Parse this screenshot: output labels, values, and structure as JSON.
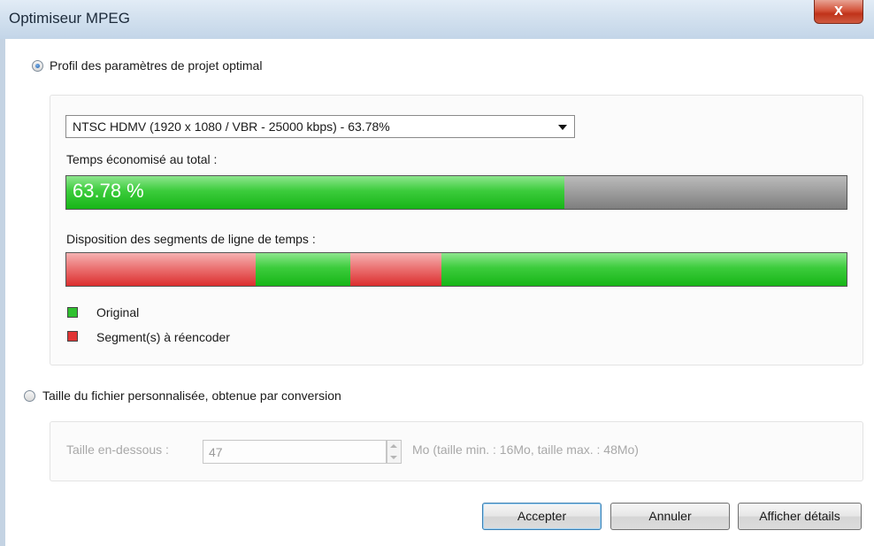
{
  "window": {
    "title": "Optimiseur MPEG",
    "close_glyph": "x"
  },
  "optimal_profile": {
    "radio_label": "Profil des paramètres de projet optimal",
    "selected": true,
    "profile_select_value": "NTSC HDMV (1920 x 1080 / VBR - 25000 kbps) - 63.78%",
    "time_saved_label": "Temps économisé au total :",
    "time_saved_percent": 63.78,
    "time_saved_text": "63.78 %",
    "timeline_label": "Disposition des segments de ligne de temps :",
    "timeline_segments": [
      {
        "type": "reencode",
        "start": 0.0,
        "end": 0.243
      },
      {
        "type": "original",
        "start": 0.243,
        "end": 0.364
      },
      {
        "type": "reencode",
        "start": 0.364,
        "end": 0.481
      },
      {
        "type": "original",
        "start": 0.481,
        "end": 1.0
      }
    ],
    "legend": [
      {
        "color": "#2fc02f",
        "label": "Original"
      },
      {
        "color": "#e03535",
        "label": "Segment(s) à réencoder"
      }
    ]
  },
  "custom_size": {
    "radio_label": "Taille du fichier personnalisée, obtenue par conversion",
    "selected": false,
    "size_label": "Taille en-dessous :",
    "size_value": "47",
    "unit_hint": "Mo  (taille min. : 16Mo, taille max. : 48Mo)"
  },
  "buttons": {
    "accept": "Accepter",
    "cancel": "Annuler",
    "details": "Afficher détails"
  },
  "colors": {
    "original": "#2fc02f",
    "reencode": "#e03535",
    "title_bar": "#d3e1ef"
  }
}
